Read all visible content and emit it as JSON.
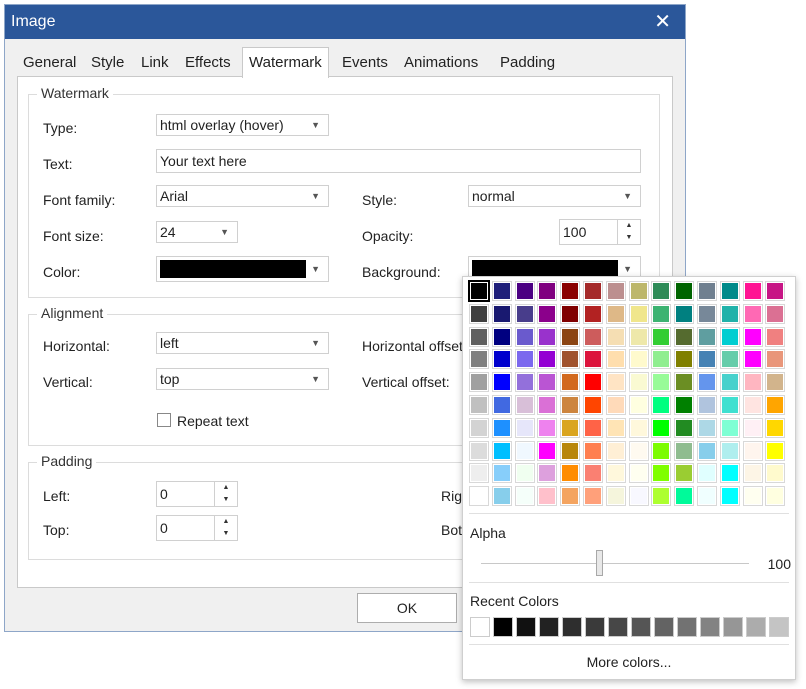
{
  "window": {
    "title": "Image",
    "close_glyph": "✕"
  },
  "tabs": [
    "General",
    "Style",
    "Link",
    "Effects",
    "Watermark",
    "Events",
    "Animations",
    "Padding"
  ],
  "active_tab": "Watermark",
  "watermark": {
    "group_title": "Watermark",
    "type_label": "Type:",
    "type_value": "html overlay (hover)",
    "text_label": "Text:",
    "text_value": "Your text here",
    "font_family_label": "Font family:",
    "font_family_value": "Arial",
    "style_label": "Style:",
    "style_value": "normal",
    "font_size_label": "Font size:",
    "font_size_value": "24",
    "opacity_label": "Opacity:",
    "opacity_value": "100",
    "color_label": "Color:",
    "color_value": "#000000",
    "background_label": "Background:",
    "background_value": "#000000"
  },
  "alignment": {
    "group_title": "Alignment",
    "horizontal_label": "Horizontal:",
    "horizontal_value": "left",
    "horizontal_offset_label": "Horizontal offset",
    "vertical_label": "Vertical:",
    "vertical_value": "top",
    "vertical_offset_label": "Vertical offset:",
    "repeat_label": "Repeat text"
  },
  "padding": {
    "group_title": "Padding",
    "left_label": "Left:",
    "left_value": "0",
    "top_label": "Top:",
    "top_value": "0",
    "right_label": "Righ",
    "bottom_label": "Bott"
  },
  "buttons": {
    "ok": "OK"
  },
  "picker": {
    "palette": [
      [
        "#000000",
        "#1f1f7a",
        "#4b0082",
        "#800080",
        "#8b0000",
        "#a52a2a",
        "#bc8f8f",
        "#bdb76b",
        "#2e8b57",
        "#006400",
        "#708090",
        "#008b8b",
        "#ff1493",
        "#c71585"
      ],
      [
        "#404040",
        "#191970",
        "#483d8b",
        "#8b008b",
        "#800000",
        "#b22222",
        "#deb887",
        "#f0e68c",
        "#3cb371",
        "#008080",
        "#778899",
        "#20b2aa",
        "#ff69b4",
        "#db7093"
      ],
      [
        "#606060",
        "#000080",
        "#6a5acd",
        "#9932cc",
        "#8b4513",
        "#cd5c5c",
        "#f5deb3",
        "#eee8aa",
        "#32cd32",
        "#556b2f",
        "#5f9ea0",
        "#00ced1",
        "#ff00ff",
        "#f08080"
      ],
      [
        "#808080",
        "#0000cd",
        "#7b68ee",
        "#9400d3",
        "#a0522d",
        "#dc143c",
        "#ffdead",
        "#fffacd",
        "#90ee90",
        "#808000",
        "#4682b4",
        "#66cdaa",
        "#ff00ff",
        "#e9967a"
      ],
      [
        "#a0a0a0",
        "#0000ff",
        "#9370db",
        "#ba55d3",
        "#d2691e",
        "#ff0000",
        "#ffe4c4",
        "#fafad2",
        "#98fb98",
        "#6b8e23",
        "#6495ed",
        "#48d1cc",
        "#ffb6c1",
        "#d2b48c"
      ],
      [
        "#c0c0c0",
        "#4169e1",
        "#d8bfd8",
        "#da70d6",
        "#cd853f",
        "#ff4500",
        "#ffdab9",
        "#ffffe0",
        "#00ff7f",
        "#008000",
        "#b0c4de",
        "#40e0d0",
        "#ffe4e1",
        "#ffa500"
      ],
      [
        "#d3d3d3",
        "#1e90ff",
        "#e6e6fa",
        "#ee82ee",
        "#daa520",
        "#ff6347",
        "#ffe4b5",
        "#fff8dc",
        "#00ff00",
        "#228b22",
        "#add8e6",
        "#7fffd4",
        "#fff0f5",
        "#ffd700"
      ],
      [
        "#dcdcdc",
        "#00bfff",
        "#f0f8ff",
        "#ff00ff",
        "#b8860b",
        "#ff7f50",
        "#ffefd5",
        "#fffaf0",
        "#7cfc00",
        "#8fbc8f",
        "#87ceeb",
        "#afeeee",
        "#fff5ee",
        "#ffff00"
      ],
      [
        "#eeeeee",
        "#87cefa",
        "#f0fff0",
        "#dda0dd",
        "#ff8c00",
        "#fa8072",
        "#fff8dc",
        "#fffff0",
        "#7fff00",
        "#9acd32",
        "#e0ffff",
        "#00ffff",
        "#fdf5e6",
        "#fffacd"
      ],
      [
        "#ffffff",
        "#87ceeb",
        "#f5fffa",
        "#ffc0cb",
        "#f4a460",
        "#ffa07a",
        "#f5f5dc",
        "#f8f8ff",
        "#adff2f",
        "#00fa9a",
        "#f0ffff",
        "#00ffff",
        "#fffff0",
        "#ffffe0"
      ]
    ],
    "alpha_label": "Alpha",
    "alpha_value": "100",
    "alpha_fraction": 0.44,
    "recent_label": "Recent Colors",
    "recent": [
      "#ffffff",
      "#000000",
      "#111111",
      "#222222",
      "#2e2e2e",
      "#3a3a3a",
      "#474747",
      "#555555",
      "#636363",
      "#727272",
      "#838383",
      "#969696",
      "#acacac",
      "#c4c4c4"
    ],
    "more_colors": "More colors..."
  }
}
